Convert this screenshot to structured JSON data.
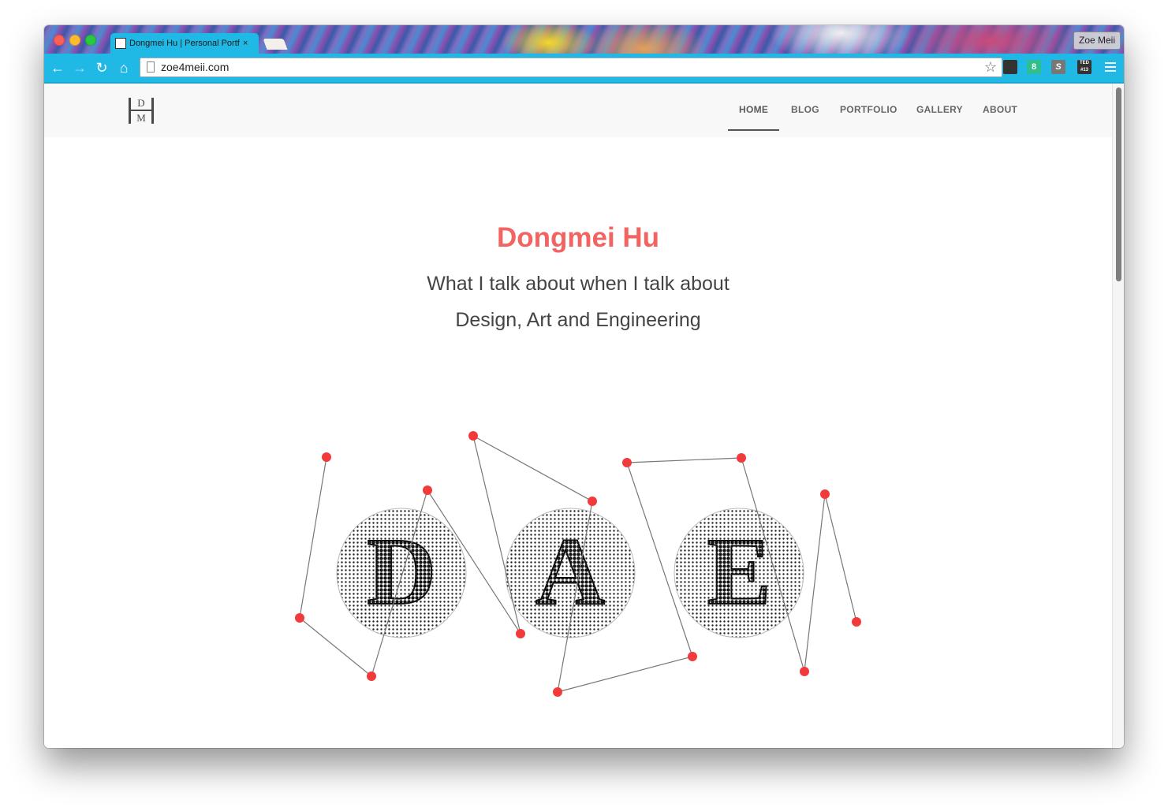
{
  "browser": {
    "tab_favicon": "DHM",
    "tab_title": "Dongmei Hu | Personal Portfolio",
    "tab_close": "×",
    "profile_name": "Zoe Meii",
    "url": "zoe4meii.com",
    "toolbar_color": "#20b9e6",
    "ext_badge_green": "8",
    "ext_badge_s": "S",
    "ext_badge_ted": "TED #13"
  },
  "site": {
    "logo": {
      "top": "D",
      "bottom": "M"
    },
    "nav": [
      "HOME",
      "BLOG",
      "PORTFOLIO",
      "GALLERY",
      "ABOUT"
    ],
    "active_nav": "HOME",
    "hero": {
      "title": "Dongmei Hu",
      "subtitle_line1": "What I talk about when I talk about",
      "subtitle_line2": "Design, Art and Engineering"
    },
    "letters": [
      "D",
      "A",
      "E"
    ],
    "accent_color": "#f26462",
    "node_color": "#f23a3a"
  }
}
